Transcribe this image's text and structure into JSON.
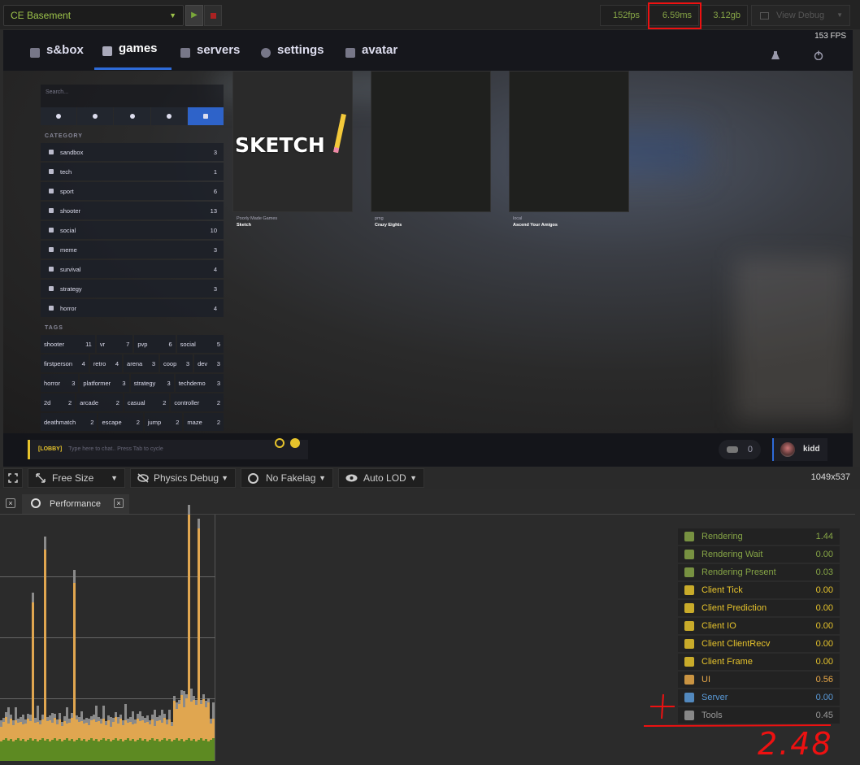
{
  "topbar": {
    "scene": "CE Basement",
    "fps": "152fps",
    "frame_ms": "6.59ms",
    "memory": "3.12gb",
    "view_debug": "View Debug"
  },
  "game": {
    "fps_overlay": "153 FPS",
    "nav": {
      "items": [
        "s&box",
        "games",
        "servers",
        "settings",
        "avatar"
      ],
      "active": "games"
    },
    "search_placeholder": "Search...",
    "category_title": "CATEGORY",
    "categories": [
      {
        "label": "sandbox",
        "count": "3"
      },
      {
        "label": "tech",
        "count": "1"
      },
      {
        "label": "sport",
        "count": "6"
      },
      {
        "label": "shooter",
        "count": "13"
      },
      {
        "label": "social",
        "count": "10"
      },
      {
        "label": "meme",
        "count": "3"
      },
      {
        "label": "survival",
        "count": "4"
      },
      {
        "label": "strategy",
        "count": "3"
      },
      {
        "label": "horror",
        "count": "4"
      }
    ],
    "tags_title": "TAGS",
    "tag_rows": [
      [
        {
          "label": "shooter",
          "count": "11"
        },
        {
          "label": "vr",
          "count": "7"
        },
        {
          "label": "pvp",
          "count": "6"
        },
        {
          "label": "social",
          "count": "5"
        }
      ],
      [
        {
          "label": "firstperson",
          "count": "4"
        },
        {
          "label": "retro",
          "count": "4"
        },
        {
          "label": "arena",
          "count": "3"
        },
        {
          "label": "coop",
          "count": "3"
        },
        {
          "label": "dev",
          "count": "3"
        }
      ],
      [
        {
          "label": "horror",
          "count": "3"
        },
        {
          "label": "platformer",
          "count": "3"
        },
        {
          "label": "strategy",
          "count": "3"
        },
        {
          "label": "techdemo",
          "count": "3"
        }
      ],
      [
        {
          "label": "2d",
          "count": "2"
        },
        {
          "label": "arcade",
          "count": "2"
        },
        {
          "label": "casual",
          "count": "2"
        },
        {
          "label": "controller",
          "count": "2"
        }
      ],
      [
        {
          "label": "deathmatch",
          "count": "2"
        },
        {
          "label": "escape",
          "count": "2"
        },
        {
          "label": "jump",
          "count": "2"
        },
        {
          "label": "maze",
          "count": "2"
        }
      ]
    ],
    "cards": [
      {
        "org": "Poorly Made Games",
        "name": "Sketch",
        "art_text": "SKETCH"
      },
      {
        "org": "pmg",
        "name": "Crazy Eights"
      },
      {
        "org": "local",
        "name": "Ascend Your Amigos"
      }
    ],
    "chat": {
      "channel": "[LOBBY]",
      "placeholder": "Type here to chat.. Press Tab to cycle"
    },
    "party_count": "0",
    "username": "kidd"
  },
  "viewport_toolbar": {
    "size": "Free Size",
    "physics": "Physics Debug",
    "fakelag": "No Fakelag",
    "lod": "Auto LOD",
    "resolution": "1049x537"
  },
  "performance": {
    "tab_label": "Performance",
    "metrics": [
      {
        "label": "Rendering",
        "value": "1.44",
        "color": "#86a546",
        "icon": "image-icon"
      },
      {
        "label": "Rendering Wait",
        "value": "0.00",
        "color": "#86a546",
        "icon": "image-dashed-icon"
      },
      {
        "label": "Rendering Present",
        "value": "0.03",
        "color": "#86a546",
        "icon": "image-dashed-icon"
      },
      {
        "label": "Client Tick",
        "value": "0.00",
        "color": "#e6c32c",
        "icon": "gear-icon"
      },
      {
        "label": "Client Prediction",
        "value": "0.00",
        "color": "#e6c32c",
        "icon": "running-icon"
      },
      {
        "label": "Client IO",
        "value": "0.00",
        "color": "#e6c32c",
        "icon": "mouse-icon"
      },
      {
        "label": "Client ClientRecv",
        "value": "0.00",
        "color": "#e6c32c",
        "icon": "wifi-icon"
      },
      {
        "label": "Client Frame",
        "value": "0.00",
        "color": "#e6c32c",
        "icon": "gears-icon"
      },
      {
        "label": "UI",
        "value": "0.56",
        "color": "#e8a848",
        "icon": "circle-icon"
      },
      {
        "label": "Server",
        "value": "0.00",
        "color": "#5a9ad8",
        "icon": "server-icon"
      },
      {
        "label": "Tools",
        "value": "0.45",
        "color": "#999999",
        "icon": "tools-icon"
      }
    ],
    "annotation_plus": "+",
    "annotation_total": "2.48"
  },
  "colors": {
    "accent_blue": "#2e6bd8",
    "accent_green": "#86a546",
    "annotation_red": "#e11111"
  }
}
